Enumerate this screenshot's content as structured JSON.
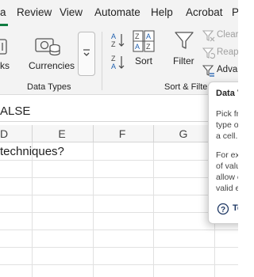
{
  "menubar": {
    "items": [
      {
        "label": "a",
        "active": true
      },
      {
        "label": "Review"
      },
      {
        "label": "View"
      },
      {
        "label": "Automate"
      },
      {
        "label": "Help"
      },
      {
        "label": "Acrobat"
      },
      {
        "label": "P"
      }
    ]
  },
  "ribbon": {
    "data_types": {
      "stocks_label": "ks",
      "currencies_label": "Currencies",
      "group_label": "Data Types"
    },
    "sort_filter": {
      "sort_label": "Sort",
      "filter_label": "Filter",
      "clear_label": "Clear",
      "reapply_label": "Reapp",
      "advanced_label": "Advan",
      "group_label": "Sort & Filter"
    }
  },
  "formula_bar": {
    "value": "ALSE"
  },
  "columns": [
    "D",
    "E",
    "F",
    "G"
  ],
  "cell_text": "techniques?",
  "tooltip": {
    "title": "Data V",
    "lines": [
      "Pick fr",
      "type o",
      "a cell.",
      "",
      "For exa",
      "of valu",
      "allow e",
      "valid e"
    ],
    "link": "Te"
  },
  "colors": {
    "accent": "#107c41",
    "link": "#1f3864"
  }
}
